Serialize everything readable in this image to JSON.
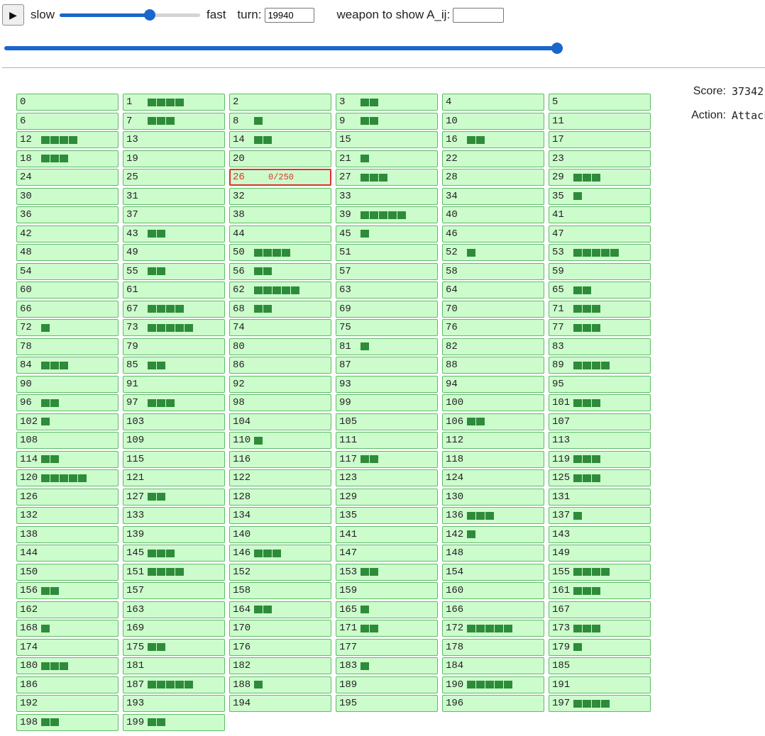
{
  "controls": {
    "play_icon": "play-icon",
    "slow_label": "slow",
    "fast_label": "fast",
    "speed_fraction": 0.64,
    "turn_label": "turn:",
    "turn_value": "19940",
    "weapon_label": "weapon to show A_ij:",
    "weapon_value": "",
    "turn_fraction": 1.0
  },
  "side": {
    "score_label": "Score:",
    "score_value": "37342",
    "action_label": "Action:",
    "action_value": "Attack"
  },
  "colors": {
    "cell_bg": "#ccfccc",
    "cell_border": "#5fba68",
    "bar": "#2e8b3a",
    "selected": "#e0302a",
    "accent": "#1a66cc"
  },
  "selected_cell": {
    "id": 26,
    "progress": "0/250"
  },
  "cells": [
    0,
    4,
    0,
    2,
    0,
    0,
    0,
    3,
    1,
    2,
    0,
    0,
    4,
    0,
    2,
    0,
    2,
    0,
    3,
    0,
    0,
    1,
    0,
    0,
    0,
    0,
    0,
    3,
    0,
    3,
    0,
    0,
    0,
    0,
    0,
    1,
    0,
    0,
    0,
    5,
    0,
    0,
    0,
    2,
    0,
    1,
    0,
    0,
    0,
    0,
    4,
    0,
    1,
    5,
    0,
    2,
    2,
    0,
    0,
    0,
    0,
    0,
    5,
    0,
    0,
    2,
    0,
    4,
    2,
    0,
    0,
    3,
    1,
    5,
    0,
    0,
    0,
    3,
    0,
    0,
    0,
    1,
    0,
    0,
    3,
    2,
    0,
    0,
    0,
    4,
    0,
    0,
    0,
    0,
    0,
    0,
    2,
    3,
    0,
    0,
    0,
    3,
    1,
    0,
    0,
    0,
    2,
    0,
    0,
    0,
    1,
    0,
    0,
    0,
    2,
    0,
    0,
    2,
    0,
    3,
    5,
    0,
    0,
    0,
    0,
    3,
    0,
    2,
    0,
    0,
    0,
    0,
    0,
    0,
    0,
    0,
    3,
    1,
    0,
    0,
    0,
    0,
    1,
    0,
    0,
    3,
    3,
    0,
    0,
    0,
    0,
    4,
    0,
    2,
    0,
    4,
    2,
    0,
    0,
    0,
    0,
    3,
    0,
    0,
    2,
    1,
    0,
    0,
    1,
    0,
    0,
    2,
    5,
    3,
    0,
    2,
    0,
    0,
    0,
    1,
    3,
    0,
    0,
    1,
    0,
    0,
    0,
    5,
    1,
    0,
    5,
    0,
    0,
    0,
    0,
    0,
    0,
    4,
    2,
    2
  ]
}
